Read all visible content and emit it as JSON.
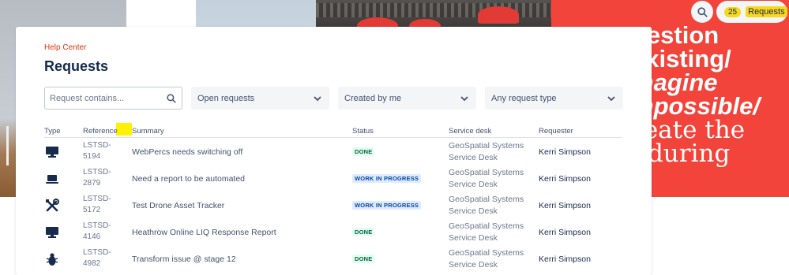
{
  "banner": {
    "lines": [
      "uestion",
      "existing/",
      "magine",
      "mpossible/",
      "reate the",
      "nduring"
    ],
    "accent_color": "#f2443a"
  },
  "topbar": {
    "search_icon": "search-icon",
    "requests_count": "25",
    "requests_label": "Requests",
    "highlight_color": "#f9d71c"
  },
  "header": {
    "breadcrumb": "Help Center",
    "title": "Requests"
  },
  "filters": {
    "search_placeholder": "Request contains...",
    "status_value": "Open requests",
    "created_value": "Created by me",
    "type_value": "Any request type"
  },
  "table": {
    "columns": {
      "type": "Type",
      "reference": "Reference",
      "summary": "Summary",
      "status": "Status",
      "service_desk": "Service desk",
      "requester": "Requester"
    },
    "rows": [
      {
        "icon": "monitor-icon",
        "ref_line1": "LSTSD-",
        "ref_line2": "5194",
        "summary": "WebPercs needs switching off",
        "status": "DONE",
        "status_kind": "done",
        "desk_line1": "GeoSpatial Systems",
        "desk_line2": "Service Desk",
        "requester": "Kerri Simpson"
      },
      {
        "icon": "laptop-icon",
        "ref_line1": "LSTSD-",
        "ref_line2": "2879",
        "summary": "Need a report to be automated",
        "status": "WORK IN PROGRESS",
        "status_kind": "wip",
        "desk_line1": "GeoSpatial Systems",
        "desk_line2": "Service Desk",
        "requester": "Kerri Simpson"
      },
      {
        "icon": "tools-icon",
        "ref_line1": "LSTSD-",
        "ref_line2": "5172",
        "summary": "Test Drone Asset Tracker",
        "status": "WORK IN PROGRESS",
        "status_kind": "wip",
        "desk_line1": "GeoSpatial Systems",
        "desk_line2": "Service Desk",
        "requester": "Kerri Simpson"
      },
      {
        "icon": "monitor-icon",
        "ref_line1": "LSTSD-",
        "ref_line2": "4146",
        "summary": "Heathrow Online LIQ Response Report",
        "status": "DONE",
        "status_kind": "done",
        "desk_line1": "GeoSpatial Systems",
        "desk_line2": "Service Desk",
        "requester": "Kerri Simpson"
      },
      {
        "icon": "bug-icon",
        "ref_line1": "LSTSD-",
        "ref_line2": "4982",
        "summary": "Transform issue @ stage 12",
        "status": "DONE",
        "status_kind": "done",
        "desk_line1": "GeoSpatial Systems",
        "desk_line2": "Service Desk",
        "requester": "Kerri Simpson"
      }
    ]
  }
}
